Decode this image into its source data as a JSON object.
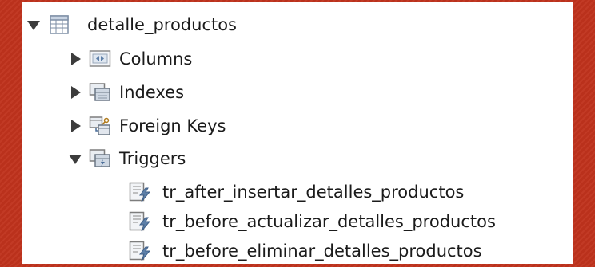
{
  "tree": {
    "table": {
      "label": "detalle_productos",
      "expanded": true
    },
    "groups": {
      "columns": {
        "label": "Columns",
        "expanded": false
      },
      "indexes": {
        "label": "Indexes",
        "expanded": false
      },
      "foreign_keys": {
        "label": "Foreign Keys",
        "expanded": false
      },
      "triggers": {
        "label": "Triggers",
        "expanded": true
      }
    },
    "triggers": [
      {
        "label": "tr_after_insertar_detalles_productos"
      },
      {
        "label": "tr_before_actualizar_detalles_productos"
      },
      {
        "label": "tr_before_eliminar_detalles_productos"
      }
    ]
  },
  "colors": {
    "background": "#c0331d",
    "panel": "#ffffff",
    "text": "#1b1b1b",
    "icon_blue": "#5d7fa8",
    "icon_gray": "#8a8a8a"
  }
}
